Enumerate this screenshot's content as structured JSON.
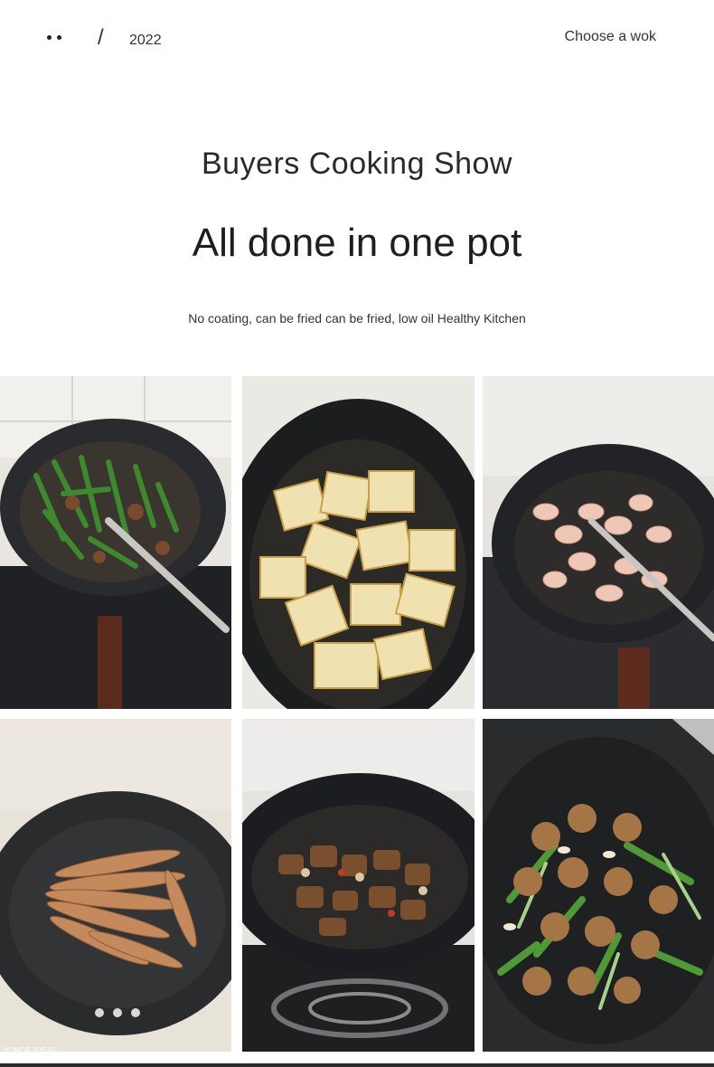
{
  "header": {
    "year": "2022",
    "nav_link": "Choose a wok"
  },
  "hero": {
    "subtitle": "Buyers Cooking Show",
    "title": "All done in one pot",
    "description": "No coating, can be fried can be fried, low oil Healthy Kitchen"
  },
  "gallery": {
    "watermark": "HONOR 30S 5G",
    "photos": [
      {
        "name": "green-beans-wok"
      },
      {
        "name": "fried-tofu-wok"
      },
      {
        "name": "shrimp-wok"
      },
      {
        "name": "fried-fish-wok"
      },
      {
        "name": "braised-meat-wok"
      },
      {
        "name": "meatballs-greens-wok"
      }
    ]
  }
}
